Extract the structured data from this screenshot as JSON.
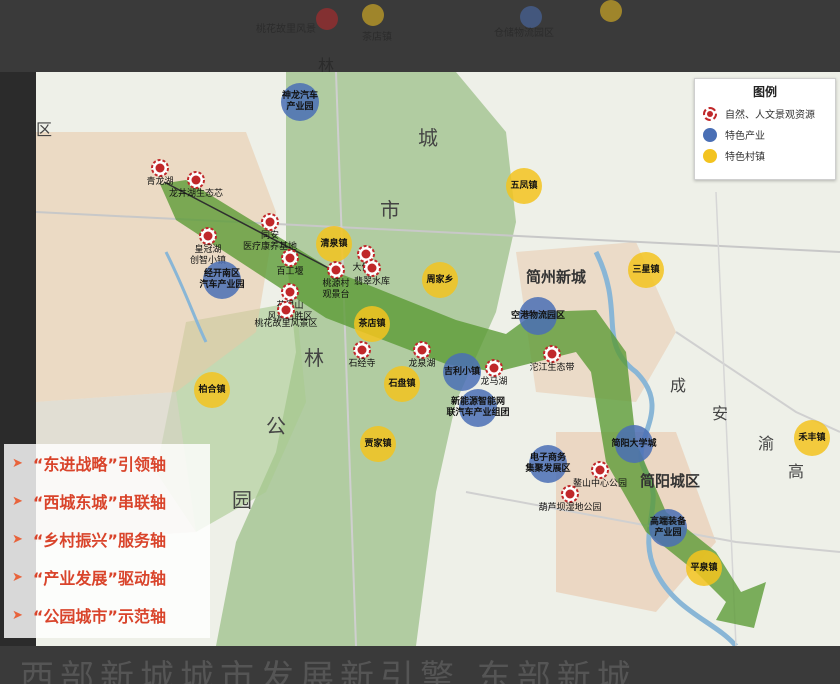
{
  "legend": {
    "title": "图例",
    "items": [
      {
        "label": "自然、人文景观资源",
        "kind": "red"
      },
      {
        "label": "特色产业",
        "kind": "blue"
      },
      {
        "label": "特色村镇",
        "kind": "yellow"
      }
    ]
  },
  "axes": [
    "“东进战略”引领轴",
    "“西城东城”串联轴",
    "“乡村振兴”服务轴",
    "“产业发展”驱动轴",
    "“公园城市”示范轴"
  ],
  "colors": {
    "red": "#c0282a",
    "blue": "#4a6fb5",
    "yellow": "#f3c31f",
    "arrow": "#5a9a33"
  },
  "district_labels": [
    "城",
    "市",
    "林",
    "公",
    "园",
    "区",
    "成",
    "安",
    "渝",
    "高"
  ],
  "city_labels": [
    "简州新城",
    "简阳城区"
  ],
  "markers": [
    {
      "kind": "blue",
      "label": "神龙汽车\n产业园"
    },
    {
      "kind": "yellow",
      "label": "五凤镇"
    },
    {
      "kind": "red",
      "label": "青龙湖"
    },
    {
      "kind": "red",
      "label": "龙井湖生态芯"
    },
    {
      "kind": "red",
      "label": "同安\n医疗康养基地"
    },
    {
      "kind": "red",
      "label": "皇冠湖\n创智小镇"
    },
    {
      "kind": "yellow",
      "label": "清泉镇"
    },
    {
      "kind": "red",
      "label": "大佛寺"
    },
    {
      "kind": "red",
      "label": "百工堰"
    },
    {
      "kind": "red",
      "label": "桃源村\n观景台"
    },
    {
      "kind": "red",
      "label": "翡翠水库"
    },
    {
      "kind": "yellow",
      "label": "周家乡"
    },
    {
      "kind": "blue",
      "label": "经开南区\n汽车产业园"
    },
    {
      "kind": "red",
      "label": "花果山\n风景名胜区"
    },
    {
      "kind": "red",
      "label": "桃花故里风景区"
    },
    {
      "kind": "yellow",
      "label": "茶店镇"
    },
    {
      "kind": "yellow",
      "label": "三星镇"
    },
    {
      "kind": "blue",
      "label": "空港物流园区"
    },
    {
      "kind": "red",
      "label": "石经寺"
    },
    {
      "kind": "red",
      "label": "龙泉湖"
    },
    {
      "kind": "yellow",
      "label": "石盘镇"
    },
    {
      "kind": "blue",
      "label": "吉利小镇"
    },
    {
      "kind": "red",
      "label": "龙马湖"
    },
    {
      "kind": "red",
      "label": "沱江生态带"
    },
    {
      "kind": "yellow",
      "label": "柏合镇"
    },
    {
      "kind": "blue",
      "label": "新能源智能网\n联汽车产业组团"
    },
    {
      "kind": "yellow",
      "label": "贾家镇"
    },
    {
      "kind": "blue",
      "label": "简阳大学城"
    },
    {
      "kind": "yellow",
      "label": "禾丰镇"
    },
    {
      "kind": "blue",
      "label": "电子商务\n集聚发展区"
    },
    {
      "kind": "red",
      "label": "鳌山中心公园"
    },
    {
      "kind": "red",
      "label": "葫芦坝湿地公园"
    },
    {
      "kind": "blue",
      "label": "高端装备\n产业园"
    },
    {
      "kind": "yellow",
      "label": "平泉镇"
    }
  ],
  "top_ghost": {
    "labels": [
      "桃花故里风景",
      "茶店镇",
      "仓储物流园区",
      "林"
    ]
  },
  "bottom_ghost": "西部新城城市发展新引擎 东部新城"
}
